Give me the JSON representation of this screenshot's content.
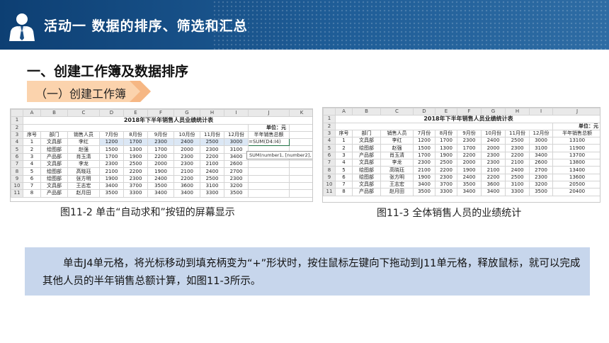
{
  "header": {
    "title": "活动一  数据的排序、筛选和汇总",
    "avatar_icon": "businessman-icon"
  },
  "section_title": "一、创建工作簿及数据排序",
  "subsection_label": "（一）创建工作簿",
  "colors": {
    "banner": "#1a4f86",
    "pill": "#fbd3ad",
    "pill_arrow": "#f6b784",
    "note": "#c7d6ec",
    "selection": "#217346"
  },
  "sheet_left": {
    "columns": [
      "",
      "A",
      "B",
      "C",
      "D",
      "E",
      "F",
      "G",
      "H",
      "I",
      "J",
      "K"
    ],
    "title": "2018年下半年销售人员业绩统计表",
    "unit": "单位：元",
    "headers": [
      "序号",
      "部门",
      "销售人员",
      "7月份",
      "8月份",
      "9月份",
      "10月份",
      "11月份",
      "12月份",
      "半年销售总额",
      ""
    ],
    "rows": [
      [
        "1",
        "文具部",
        "李红",
        "1200",
        "1700",
        "2300",
        "2400",
        "2500",
        "3000"
      ],
      [
        "2",
        "绘图部",
        "赵强",
        "1500",
        "1300",
        "1700",
        "2000",
        "2300",
        "3100"
      ],
      [
        "3",
        "产品部",
        "肖玉清",
        "1700",
        "1900",
        "2200",
        "2300",
        "2200",
        "3400"
      ],
      [
        "4",
        "文具部",
        "李龙",
        "2300",
        "2500",
        "2000",
        "2300",
        "2100",
        "2600"
      ],
      [
        "5",
        "绘图部",
        "高晓珏",
        "2100",
        "2200",
        "1900",
        "2100",
        "2400",
        "2700"
      ],
      [
        "6",
        "绘图部",
        "张方明",
        "1900",
        "2300",
        "2400",
        "2200",
        "2500",
        "2300"
      ],
      [
        "7",
        "文具部",
        "王志宏",
        "3400",
        "3700",
        "3500",
        "3600",
        "3100",
        "3200"
      ],
      [
        "8",
        "产品部",
        "赵月田",
        "3500",
        "3300",
        "3400",
        "3400",
        "3300",
        "3500"
      ]
    ],
    "formula": "=SUM(D4:I4)",
    "tooltip": "SUM(number1, [number2], ...)"
  },
  "sheet_right": {
    "columns": [
      "",
      "A",
      "B",
      "C",
      "D",
      "E",
      "F",
      "G",
      "H",
      "I",
      "J"
    ],
    "title": "2018年下半年销售人员业绩统计表",
    "unit": "单位：元",
    "headers": [
      "序号",
      "部门",
      "销售人员",
      "7月份",
      "8月份",
      "9月份",
      "10月份",
      "11月份",
      "12月份",
      "半年销售总额"
    ],
    "rows": [
      [
        "1",
        "文具部",
        "李红",
        "1200",
        "1700",
        "2300",
        "2400",
        "2500",
        "3000",
        "13100"
      ],
      [
        "2",
        "绘图部",
        "赵强",
        "1500",
        "1300",
        "1700",
        "2000",
        "2300",
        "3100",
        "11900"
      ],
      [
        "3",
        "产品部",
        "肖玉清",
        "1700",
        "1900",
        "2200",
        "2300",
        "2200",
        "3400",
        "13700"
      ],
      [
        "4",
        "文具部",
        "李龙",
        "2300",
        "2500",
        "2000",
        "2300",
        "2100",
        "2600",
        "13800"
      ],
      [
        "5",
        "绘图部",
        "高晓珏",
        "2100",
        "2200",
        "1900",
        "2100",
        "2400",
        "2700",
        "13400"
      ],
      [
        "6",
        "绘图部",
        "张方明",
        "1900",
        "2300",
        "2400",
        "2200",
        "2500",
        "2300",
        "13600"
      ],
      [
        "7",
        "文具部",
        "王志宏",
        "3400",
        "3700",
        "3500",
        "3600",
        "3100",
        "3200",
        "20500"
      ],
      [
        "8",
        "产品部",
        "赵月田",
        "3500",
        "3300",
        "3400",
        "3400",
        "3300",
        "3500",
        "20400"
      ]
    ]
  },
  "caption_left": "图11-2  单击“自动求和”按钮的屏幕显示",
  "caption_right": "图11-3  全体销售人员的业绩统计",
  "note": "单击J4单元格，将光标移动到填充柄变为“+”形状时，按住鼠标左键向下拖动到J11单元格，释放鼠标，就可以完成其他人员的半年销售总额计算，如图11-3所示。"
}
